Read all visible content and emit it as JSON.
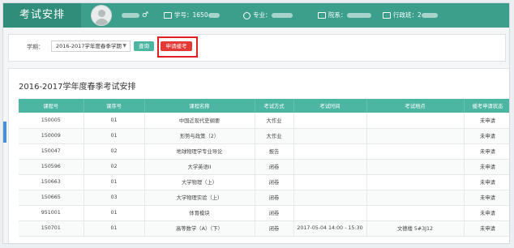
{
  "header": {
    "app_title": "考试安排",
    "gender_symbol": "♂",
    "student_id_label": "学号：1650",
    "major_label": "专业：",
    "department_label": "院系：",
    "class_label": "行政班：2"
  },
  "filter": {
    "term_label": "学期：",
    "term_value": "2016-2017学年度春季学期",
    "query_label": "查询",
    "apply_label": "申请缓考"
  },
  "panel": {
    "title": "2016-2017学年度春季考试安排"
  },
  "table": {
    "headers": [
      "课程号",
      "课序号",
      "课程名称",
      "考试方式",
      "考试时间",
      "考试地点",
      "缓考申请状态"
    ],
    "rows": [
      [
        "150005",
        "01",
        "中国近现代史纲要",
        "大作业",
        "",
        "",
        "未申请"
      ],
      [
        "150009",
        "01",
        "形势与政策（2）",
        "大作业",
        "",
        "",
        "未申请"
      ],
      [
        "150047",
        "02",
        "地球物理学专业导论",
        "报告",
        "",
        "",
        "未申请"
      ],
      [
        "150596",
        "02",
        "大学英语II",
        "闭卷",
        "",
        "",
        "未申请"
      ],
      [
        "150663",
        "01",
        "大学物理（上）",
        "闭卷",
        "",
        "",
        "未申请"
      ],
      [
        "150665",
        "03",
        "大学物理实验（上）",
        "闭卷",
        "",
        "",
        "未申请"
      ],
      [
        "951001",
        "01",
        "体育模块",
        "闭卷",
        "",
        "",
        "未申请"
      ],
      [
        "150701",
        "01",
        "高等数学（A）（下）",
        "闭卷",
        "2017-05-04 14:00 - 15:30",
        "文德楼 5#3J12",
        "未申请"
      ]
    ]
  },
  "colors": {
    "header_bg": "#3b9f8c",
    "table_header_bg": "#4db6a3",
    "apply_button": "#e53935",
    "highlight_box": "#e02020"
  }
}
